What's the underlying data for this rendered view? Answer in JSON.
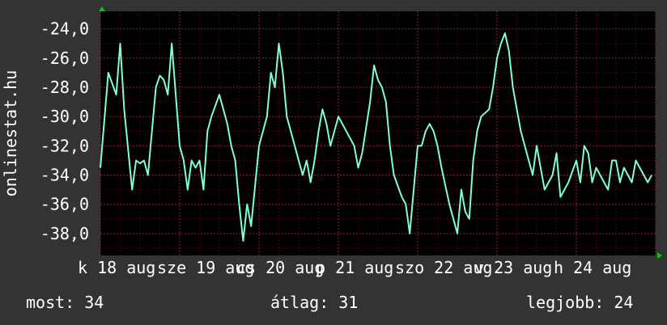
{
  "chart_data": {
    "type": "line",
    "ylabel": "onlinestat.hu",
    "yticks": [
      "-24,0",
      "-26,0",
      "-28,0",
      "-30,0",
      "-32,0",
      "-34,0",
      "-36,0",
      "-38,0"
    ],
    "ytick_values": [
      -24,
      -26,
      -28,
      -30,
      -32,
      -34,
      -36,
      -38
    ],
    "ylim": [
      -39.5,
      -22.8
    ],
    "xlim": [
      0,
      7
    ],
    "xtick_labels": [
      "k 18 aug",
      "sze 19 aug",
      "cs 20 aug",
      "p 21 aug",
      "szo 22 aug",
      "v 23 aug",
      "h 24 aug"
    ],
    "xtick_positions": [
      0,
      1,
      2,
      3,
      4,
      5,
      6
    ],
    "grid": true,
    "series": [
      {
        "color": "#7fffd4",
        "x": [
          0,
          0.1,
          0.2,
          0.25,
          0.3,
          0.4,
          0.45,
          0.5,
          0.55,
          0.6,
          0.7,
          0.75,
          0.8,
          0.85,
          0.9,
          1.0,
          1.05,
          1.1,
          1.15,
          1.2,
          1.25,
          1.3,
          1.35,
          1.4,
          1.5,
          1.6,
          1.65,
          1.7,
          1.75,
          1.8,
          1.85,
          1.9,
          2.0,
          2.05,
          2.1,
          2.15,
          2.2,
          2.25,
          2.3,
          2.35,
          2.4,
          2.5,
          2.55,
          2.6,
          2.65,
          2.7,
          2.75,
          2.8,
          2.85,
          2.9,
          3.0,
          3.1,
          3.2,
          3.25,
          3.3,
          3.4,
          3.45,
          3.5,
          3.55,
          3.6,
          3.65,
          3.7,
          3.8,
          3.85,
          3.9,
          4.0,
          4.05,
          4.1,
          4.15,
          4.2,
          4.25,
          4.3,
          4.4,
          4.5,
          4.55,
          4.6,
          4.65,
          4.7,
          4.75,
          4.8,
          4.9,
          4.95,
          5.0,
          5.05,
          5.1,
          5.15,
          5.2,
          5.3,
          5.4,
          5.45,
          5.5,
          5.55,
          5.6,
          5.7,
          5.75,
          5.8,
          5.85,
          5.9,
          6.0,
          6.05,
          6.1,
          6.15,
          6.2,
          6.25,
          6.3,
          6.4,
          6.45,
          6.5,
          6.55,
          6.6,
          6.7,
          6.75,
          6.8,
          6.9,
          6.95
        ],
        "y": [
          -33.5,
          -27.0,
          -28.5,
          -25.0,
          -29.5,
          -35.0,
          -33.0,
          -33.2,
          -33.0,
          -34.0,
          -28.0,
          -27.2,
          -27.5,
          -28.5,
          -25.0,
          -32.0,
          -33.0,
          -35.0,
          -33.0,
          -33.5,
          -33.0,
          -35.0,
          -31.0,
          -30.0,
          -28.5,
          -30.5,
          -32.0,
          -33.0,
          -36.0,
          -38.5,
          -36.0,
          -37.5,
          -32.0,
          -31.0,
          -30.0,
          -27.0,
          -28.0,
          -25.0,
          -27.0,
          -30.0,
          -31.0,
          -33.0,
          -34.0,
          -33.0,
          -34.5,
          -33.0,
          -31.0,
          -29.5,
          -30.5,
          -32.0,
          -30.0,
          -31.0,
          -32.0,
          -33.5,
          -32.5,
          -29.0,
          -26.5,
          -27.5,
          -28.0,
          -29.0,
          -32.0,
          -34.0,
          -35.5,
          -36.0,
          -38.0,
          -32.0,
          -32.0,
          -31.0,
          -30.5,
          -31.0,
          -32.0,
          -33.5,
          -36.0,
          -38.0,
          -35.0,
          -36.5,
          -37.0,
          -33.0,
          -31.0,
          -30.0,
          -29.5,
          -28.0,
          -26.0,
          -25.0,
          -24.3,
          -25.5,
          -28.0,
          -31.0,
          -33.0,
          -34.0,
          -32.0,
          -33.5,
          -35.0,
          -34.0,
          -32.5,
          -35.5,
          -35.0,
          -34.5,
          -33.0,
          -34.5,
          -32.0,
          -32.5,
          -34.5,
          -33.5,
          -34.0,
          -35.0,
          -33.0,
          -33.0,
          -34.5,
          -33.5,
          -34.5,
          -33.0,
          -33.5,
          -34.5,
          -34.0
        ]
      }
    ]
  },
  "footer": {
    "current": "most: 34",
    "average": "átlag: 31",
    "best": "legjobb: 24"
  },
  "colors": {
    "background": "#333333",
    "plot_background": "#000000",
    "grid": "#8b2a2a",
    "line": "#7fffd4",
    "axis_arrow": "#00cc00"
  }
}
